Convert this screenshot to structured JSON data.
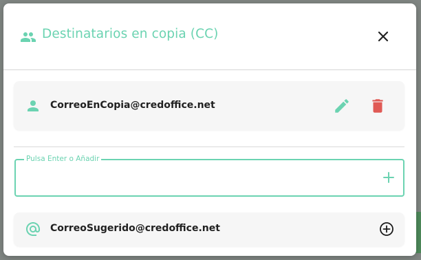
{
  "dialog": {
    "title": "Destinatarios en copia (CC)",
    "title_icon": "people-icon",
    "close_icon": "close-icon"
  },
  "recipients": [
    {
      "email": "CorreoEnCopia@credoffice.net",
      "icon": "person-icon",
      "edit_icon": "pencil-icon",
      "delete_icon": "trash-icon"
    }
  ],
  "input": {
    "label": "Pulsa Enter o Añadir",
    "value": "",
    "add_icon": "plus-icon"
  },
  "suggestions": [
    {
      "email": "CorreoSugerido@credoffice.net",
      "icon": "at-sign-icon",
      "add_icon": "add-circle-icon"
    }
  ],
  "colors": {
    "accent": "#6bd3b1",
    "delete": "#e05a55",
    "text": "#212121",
    "card_bg": "#f6f6f6"
  }
}
